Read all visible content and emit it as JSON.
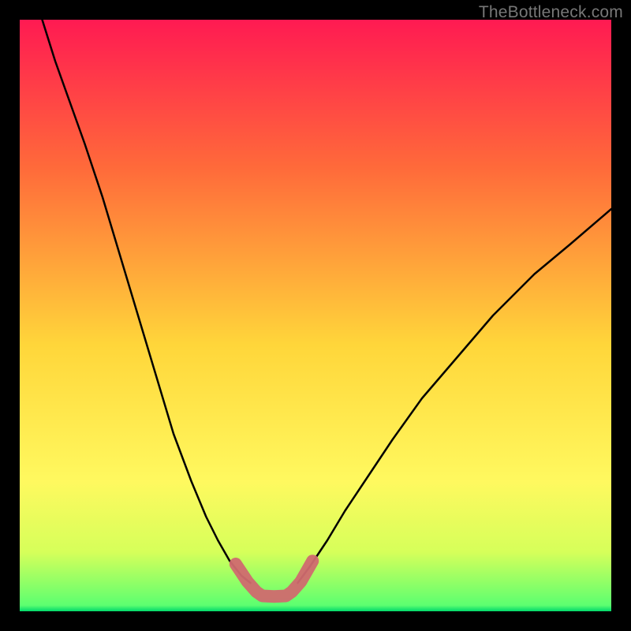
{
  "watermark": "TheBottleneck.com",
  "chart_data": {
    "type": "line",
    "title": "",
    "xlabel": "",
    "ylabel": "",
    "xlim": [
      0,
      1
    ],
    "ylim": [
      0,
      1
    ],
    "background_gradient": [
      "#ff1a52",
      "#ff6a3a",
      "#ffd63a",
      "#fff95f",
      "#d6ff5a",
      "#00e56b"
    ],
    "series": [
      {
        "name": "left-curve",
        "stroke": "#000000",
        "x": [
          0.038,
          0.06,
          0.085,
          0.11,
          0.14,
          0.17,
          0.2,
          0.23,
          0.26,
          0.29,
          0.315,
          0.335,
          0.355,
          0.375,
          0.39
        ],
        "y": [
          1.0,
          0.93,
          0.86,
          0.79,
          0.7,
          0.6,
          0.5,
          0.4,
          0.3,
          0.22,
          0.16,
          0.12,
          0.085,
          0.06,
          0.048
        ]
      },
      {
        "name": "right-curve",
        "stroke": "#000000",
        "x": [
          0.47,
          0.49,
          0.52,
          0.55,
          0.59,
          0.63,
          0.68,
          0.74,
          0.8,
          0.87,
          0.93,
          1.0
        ],
        "y": [
          0.048,
          0.075,
          0.12,
          0.17,
          0.23,
          0.29,
          0.36,
          0.43,
          0.5,
          0.57,
          0.62,
          0.68
        ]
      },
      {
        "name": "highlight-band",
        "stroke": "#d06a6f",
        "x": [
          0.365,
          0.385,
          0.4,
          0.41,
          0.43,
          0.45,
          0.46,
          0.475,
          0.495
        ],
        "y": [
          0.08,
          0.05,
          0.033,
          0.026,
          0.025,
          0.026,
          0.033,
          0.05,
          0.085
        ]
      }
    ]
  }
}
